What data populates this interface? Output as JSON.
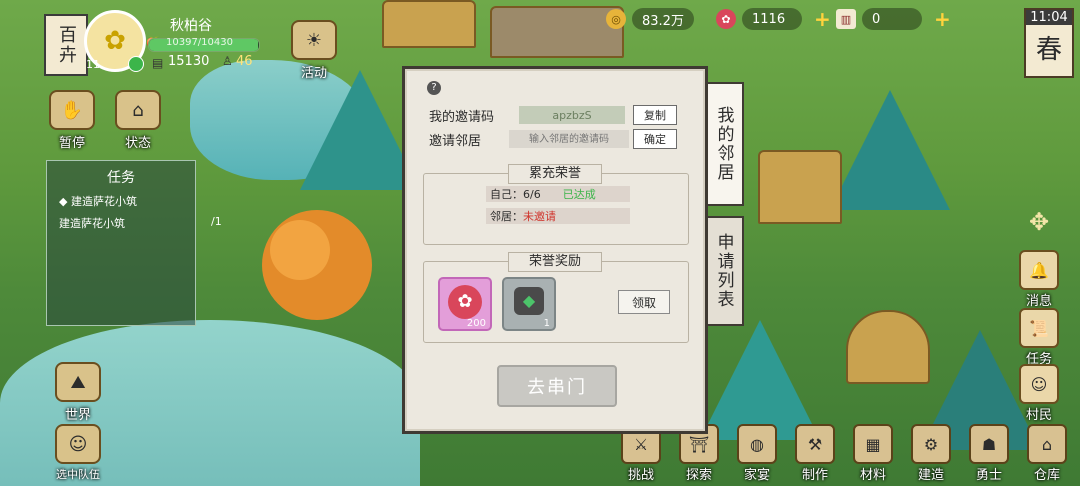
{
  "player": {
    "server": "百卉",
    "name": "秋柏谷",
    "level": "11",
    "exp_text": "10397/10430",
    "exp_fraction": 0.99,
    "wood": "15130",
    "population": "46"
  },
  "left_menu": {
    "activity": "活动",
    "pause": "暂停",
    "status": "状态",
    "world": "世界",
    "team": "选中队伍"
  },
  "tasks": {
    "title": "任务",
    "items": [
      "建造萨花小筑",
      "建造萨花小筑"
    ],
    "progress": "/1"
  },
  "resources": {
    "coins": "83.2万",
    "flowers": "1116",
    "tickets": "0"
  },
  "clock": {
    "time": "11:04",
    "season": "春"
  },
  "right_menu": [
    "消息",
    "任务",
    "村民"
  ],
  "bottom_menu": [
    "挑战",
    "探索",
    "家宴",
    "制作",
    "材料",
    "建造",
    "勇士",
    "仓库"
  ],
  "dialog": {
    "help": "?",
    "my_code_label": "我的邀请码",
    "my_code_value": "apzbzS",
    "copy_button": "复制",
    "invite_label": "邀请邻居",
    "invite_placeholder": "输入邻居的邀请码",
    "confirm_button": "确定",
    "honor_title": "累充荣誉",
    "self_label": "自己：6/6",
    "self_status": "已达成",
    "neighbor_label": "邻居：",
    "neighbor_status": "未邀请",
    "reward_title": "荣誉奖励",
    "reward1_count": "200",
    "reward2_count": "1",
    "claim_button": "领取",
    "go_button": "去串门"
  },
  "tabs": {
    "my_neighbors": "我的邻居",
    "apply_list": "申请列表"
  },
  "colors": {
    "achieved": "#3cb54a",
    "not_invited": "#d0342c"
  }
}
